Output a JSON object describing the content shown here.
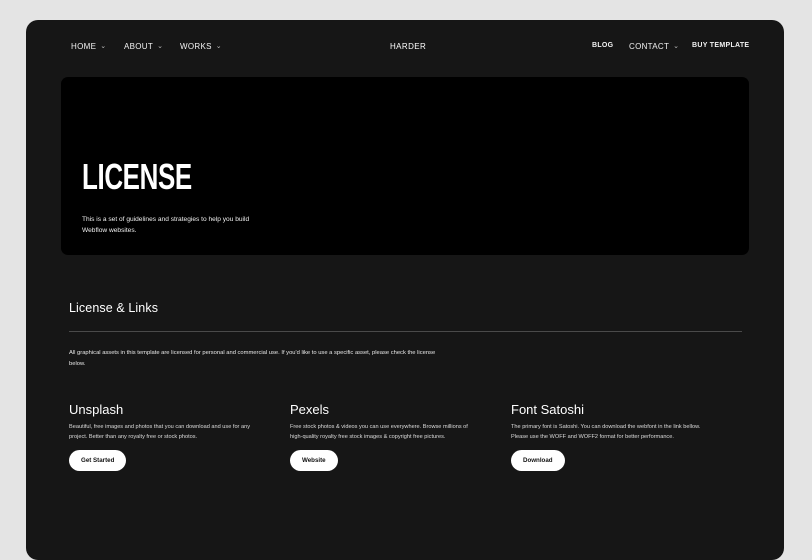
{
  "nav": {
    "left": [
      {
        "label": "HOME",
        "has_dropdown": true
      },
      {
        "label": "ABOUT",
        "has_dropdown": true
      },
      {
        "label": "WORKS",
        "has_dropdown": true
      }
    ],
    "brand": "HARDER",
    "right": [
      {
        "label": "BLOG",
        "has_dropdown": false
      },
      {
        "label": "CONTACT",
        "has_dropdown": true
      },
      {
        "label": "BUY TEMPLATE",
        "has_dropdown": false
      }
    ]
  },
  "hero": {
    "title": "LICENSE",
    "subtitle": "This is a set of guidelines and strategies to help you build Webflow websites."
  },
  "section": {
    "title": "License & Links",
    "description": "All graphical assets in this template are licensed for personal and commercial use. If you'd like to use a specific asset, please check the license below."
  },
  "cards": [
    {
      "title": "Unsplash",
      "text": "Beautiful, free images and photos that you can download and use for any project. Better than any royalty free or stock photos.",
      "button": "Get Started"
    },
    {
      "title": "Pexels",
      "text": "Free stock photos & videos you can use everywhere. Browse millions of high-quality royalty free stock images & copyright free pictures.",
      "button": "Website"
    },
    {
      "title": "Font Satoshi",
      "text": "The primary font is Satoshi. You can download the webfont in the link bellow. Please use the WOFF and WOFF2 format for better performance.",
      "button": "Download"
    }
  ],
  "icons": {
    "dropdown": "chevron-down-icon"
  },
  "colors": {
    "page_bg": "#e4e4e4",
    "frame_bg": "#161616",
    "hero_bg": "#000000",
    "button_bg": "#ffffff"
  }
}
